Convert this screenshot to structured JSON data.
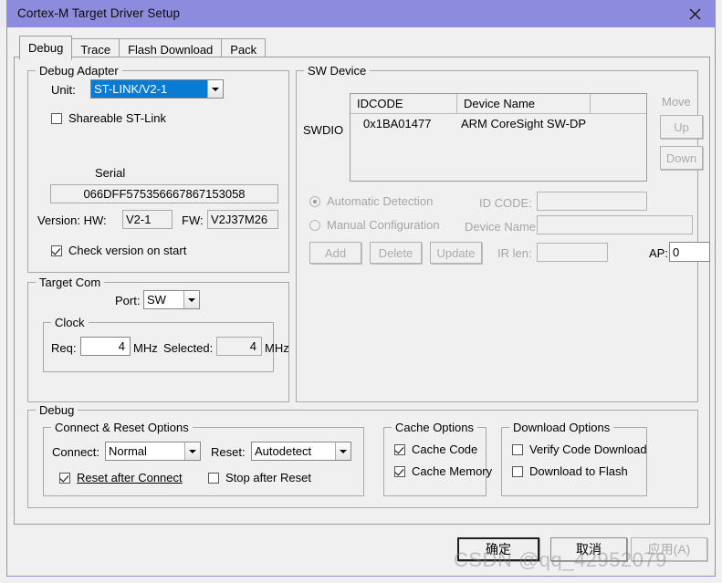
{
  "window": {
    "title": "Cortex-M Target Driver Setup",
    "close_icon": "close-x-icon",
    "titlebar_color": "#8d8bdb"
  },
  "tabs": [
    {
      "label": "Debug",
      "active": true
    },
    {
      "label": "Trace",
      "active": false
    },
    {
      "label": "Flash Download",
      "active": false
    },
    {
      "label": "Pack",
      "active": false
    }
  ],
  "debug_adapter": {
    "legend": "Debug Adapter",
    "unit_label": "Unit:",
    "unit_value": "ST-LINK/V2-1",
    "unit_selected_highlight": "#0a7bd3",
    "shareable_label": "Shareable ST-Link",
    "shareable_checked": false,
    "serial_label": "Serial",
    "serial_value": "066DFF575356667867153058",
    "version_label": "Version: HW:",
    "hw_value": "V2-1",
    "fw_label": "FW:",
    "fw_value": "V2J37M26",
    "check_version_label": "Check version on start",
    "check_version_checked": true
  },
  "target_com": {
    "legend": "Target Com",
    "port_label": "Port:",
    "port_value": "SW",
    "clock_legend": "Clock",
    "req_label": "Req:",
    "req_value": "4",
    "req_unit": "MHz",
    "selected_label": "Selected:",
    "selected_value": "4",
    "selected_unit": "MHz"
  },
  "sw_device": {
    "legend": "SW Device",
    "swdio_label": "SWDIO",
    "columns": [
      "IDCODE",
      "Device Name",
      ""
    ],
    "rows": [
      {
        "idcode": "0x1BA01477",
        "device_name": "ARM CoreSight SW-DP",
        "extra": ""
      }
    ],
    "move_label": "Move",
    "up_label": "Up",
    "down_label": "Down",
    "automatic_detection_label": "Automatic Detection",
    "automatic_detection_selected": true,
    "manual_configuration_label": "Manual Configuration",
    "manual_configuration_selected": false,
    "idcode_label": "ID CODE:",
    "idcode_value": "",
    "device_name_label": "Device Name:",
    "device_name_value": "",
    "add_label": "Add",
    "delete_label": "Delete",
    "update_label": "Update",
    "irlen_label": "IR len:",
    "irlen_value": "",
    "ap_label": "AP:",
    "ap_value": "0"
  },
  "debug_group": {
    "legend": "Debug",
    "connect_reset": {
      "legend": "Connect & Reset Options",
      "connect_label": "Connect:",
      "connect_value": "Normal",
      "reset_label": "Reset:",
      "reset_value": "Autodetect",
      "reset_after_connect_label": "Reset after Connect",
      "reset_after_connect_accel": "R",
      "reset_after_connect_checked": true,
      "stop_after_reset_label": "Stop after Reset",
      "stop_after_reset_accel": "S",
      "stop_after_reset_checked": false
    },
    "cache_options": {
      "legend": "Cache Options",
      "cache_code_label": "Cache Code",
      "cache_code_accel": "C",
      "cache_code_checked": true,
      "cache_memory_label": "Cache Memory",
      "cache_memory_accel": "M",
      "cache_memory_checked": true
    },
    "download_options": {
      "legend": "Download Options",
      "verify_label": "Verify Code Download",
      "verify_accel": "V",
      "verify_checked": false,
      "download_flash_label": "Download to Flash",
      "download_flash_accel": "F",
      "download_flash_checked": false
    }
  },
  "footer": {
    "ok_label": "确定",
    "cancel_label": "取消",
    "apply_label": "应用(A)",
    "apply_disabled": true
  },
  "watermark": {
    "text": "CSDN @qq_42952079"
  }
}
